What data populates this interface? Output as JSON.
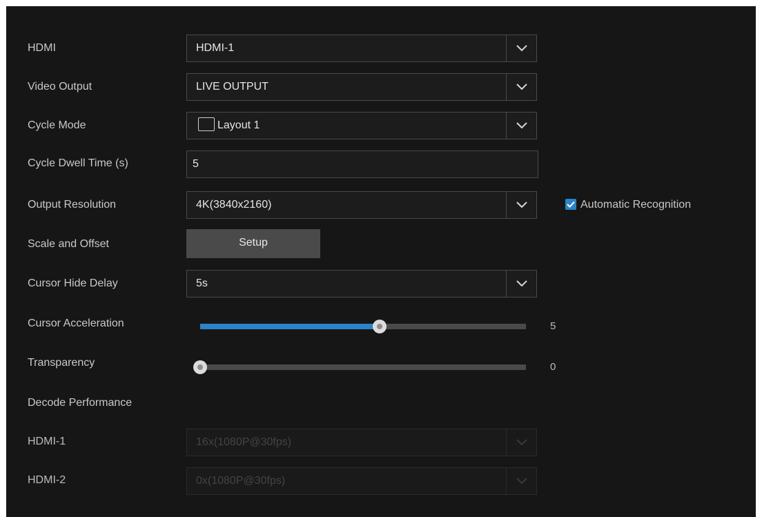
{
  "settings": {
    "hdmi": {
      "label": "HDMI",
      "value": "HDMI-1"
    },
    "video_output": {
      "label": "Video Output",
      "value": "LIVE OUTPUT"
    },
    "cycle_mode": {
      "label": "Cycle Mode",
      "value": "Layout 1"
    },
    "cycle_dwell_time": {
      "label": "Cycle Dwell Time (s)",
      "value": "5"
    },
    "output_resolution": {
      "label": "Output Resolution",
      "value": "4K(3840x2160)"
    },
    "automatic_recognition": {
      "label": "Automatic Recognition",
      "checked": true
    },
    "scale_offset": {
      "label": "Scale and Offset",
      "button": "Setup"
    },
    "cursor_hide_delay": {
      "label": "Cursor Hide Delay",
      "value": "5s"
    },
    "cursor_acceleration": {
      "label": "Cursor Acceleration",
      "value": "5",
      "level": 0.55
    },
    "transparency": {
      "label": "Transparency",
      "value": "0",
      "level": 0.0
    },
    "decode_performance": {
      "label": "Decode Performance"
    },
    "decode_hdmi1": {
      "label": "HDMI-1",
      "value": "16x(1080P@30fps)"
    },
    "decode_hdmi2": {
      "label": "HDMI-2",
      "value": "0x(1080P@30fps)"
    }
  },
  "icons": {
    "dropdown": "chevron-down-icon",
    "check": "checkmark-icon"
  },
  "colors": {
    "background": "#161616",
    "accent": "#2b84c6",
    "button": "#4a4a4a",
    "text": "#c9c9c9"
  }
}
